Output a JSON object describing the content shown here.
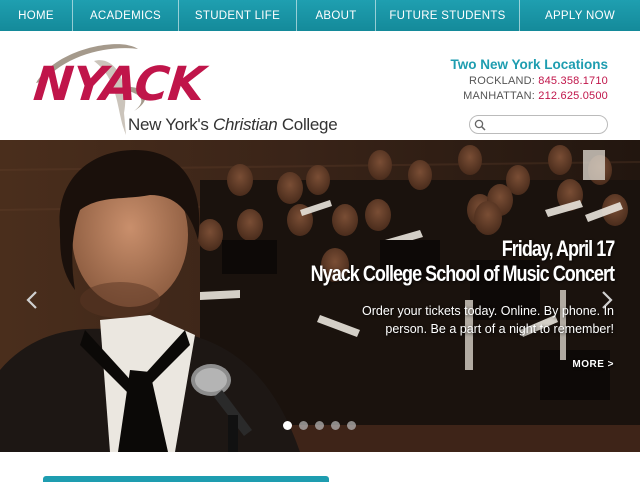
{
  "nav": {
    "items": [
      {
        "label": "HOME"
      },
      {
        "label": "ACADEMICS"
      },
      {
        "label": "STUDENT LIFE"
      },
      {
        "label": "ABOUT"
      },
      {
        "label": "FUTURE STUDENTS"
      },
      {
        "label": "APPLY NOW"
      }
    ]
  },
  "logo": {
    "word": "NYACK",
    "tagline_pre": "New York's ",
    "tagline_em": "Christian",
    "tagline_post": " College",
    "brand_color": "#c0154a"
  },
  "locations": {
    "title": "Two New York Locations",
    "rockland_label": "ROCKLAND:",
    "rockland_phone": "845.358.1710",
    "manhattan_label": "MANHATTAN:",
    "manhattan_phone": "212.625.0500",
    "accent_color": "#1e9db0"
  },
  "search": {
    "placeholder": "",
    "icon": "search-icon"
  },
  "hero": {
    "date": "Friday, April 17",
    "title": "Nyack College School of Music Concert",
    "description": "Order your tickets today. Online. By phone. In person. Be a part of a night to remember!",
    "more_label": "MORE >",
    "slide_count": 5,
    "active_slide": 1,
    "prev_icon": "chevron-left-icon",
    "next_icon": "chevron-right-icon"
  }
}
